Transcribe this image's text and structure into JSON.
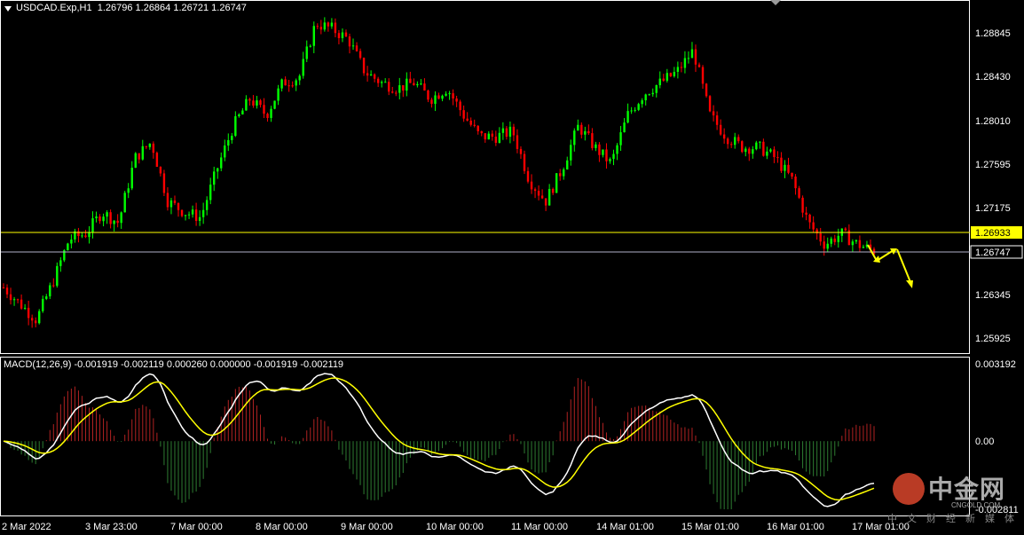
{
  "header": {
    "symbol": "USDCAD.Exp,H1",
    "ohlc": "1.26796 1.26864 1.26721 1.26747"
  },
  "macd": {
    "label": "MACD(12,26,9) -0.001919 -0.002119 0.000260 0.000000 -0.001919 -0.002119",
    "levels": [
      "0.003192",
      "0.00",
      "-0.002811"
    ]
  },
  "price_axis": {
    "ticks": [
      "1.28845",
      "1.28430",
      "1.28010",
      "1.27595",
      "1.27175",
      "1.26345",
      "1.25925"
    ],
    "hline_yellow": "1.26933",
    "hline_gray": "1.26747"
  },
  "time_axis": {
    "labels": [
      "2 Mar 2022",
      "3 Mar 23:00",
      "7 Mar 00:00",
      "8 Mar 00:00",
      "9 Mar 00:00",
      "10 Mar 00:00",
      "11 Mar 00:00",
      "14 Mar 01:00",
      "15 Mar 01:00",
      "16 Mar 01:00",
      "17 Mar 01:00"
    ]
  },
  "watermark": {
    "brand": "中金网",
    "domain": "CNGOLD.COM",
    "tagline": "中文财经新媒体"
  },
  "colors": {
    "bull": "#00ff00",
    "bear": "#ff0000",
    "hist_pos": "#b22222",
    "hist_neg": "#2e7d32",
    "macd_line": "#ffffff",
    "signal_line": "#ffff00",
    "annotation": "#ffff00",
    "grid_frame": "#ffffff"
  },
  "chart_data": {
    "type": "candlestick",
    "series": [
      {
        "name": "USDCAD.Exp,H1",
        "close_path": [
          1.264,
          1.2625,
          1.261,
          1.2645,
          1.2685,
          1.269,
          1.271,
          1.27,
          1.276,
          1.2775,
          1.272,
          1.271,
          1.2705,
          1.275,
          1.279,
          1.2815,
          1.28,
          1.283,
          1.2835,
          1.2885,
          1.288,
          1.287,
          1.284,
          1.283,
          1.2825,
          1.283,
          1.2815,
          1.2825,
          1.28,
          1.278,
          1.278,
          1.2785,
          1.274,
          1.272,
          1.275,
          1.279,
          1.277,
          1.2755,
          1.28,
          1.282,
          1.283,
          1.284,
          1.286,
          1.28,
          1.278,
          1.277,
          1.277,
          1.276,
          1.274,
          1.27,
          1.268,
          1.269,
          1.268,
          1.2674
        ]
      }
    ],
    "hlines": [
      1.26933,
      1.26747
    ],
    "ylim": [
      1.258,
      1.2905
    ]
  }
}
